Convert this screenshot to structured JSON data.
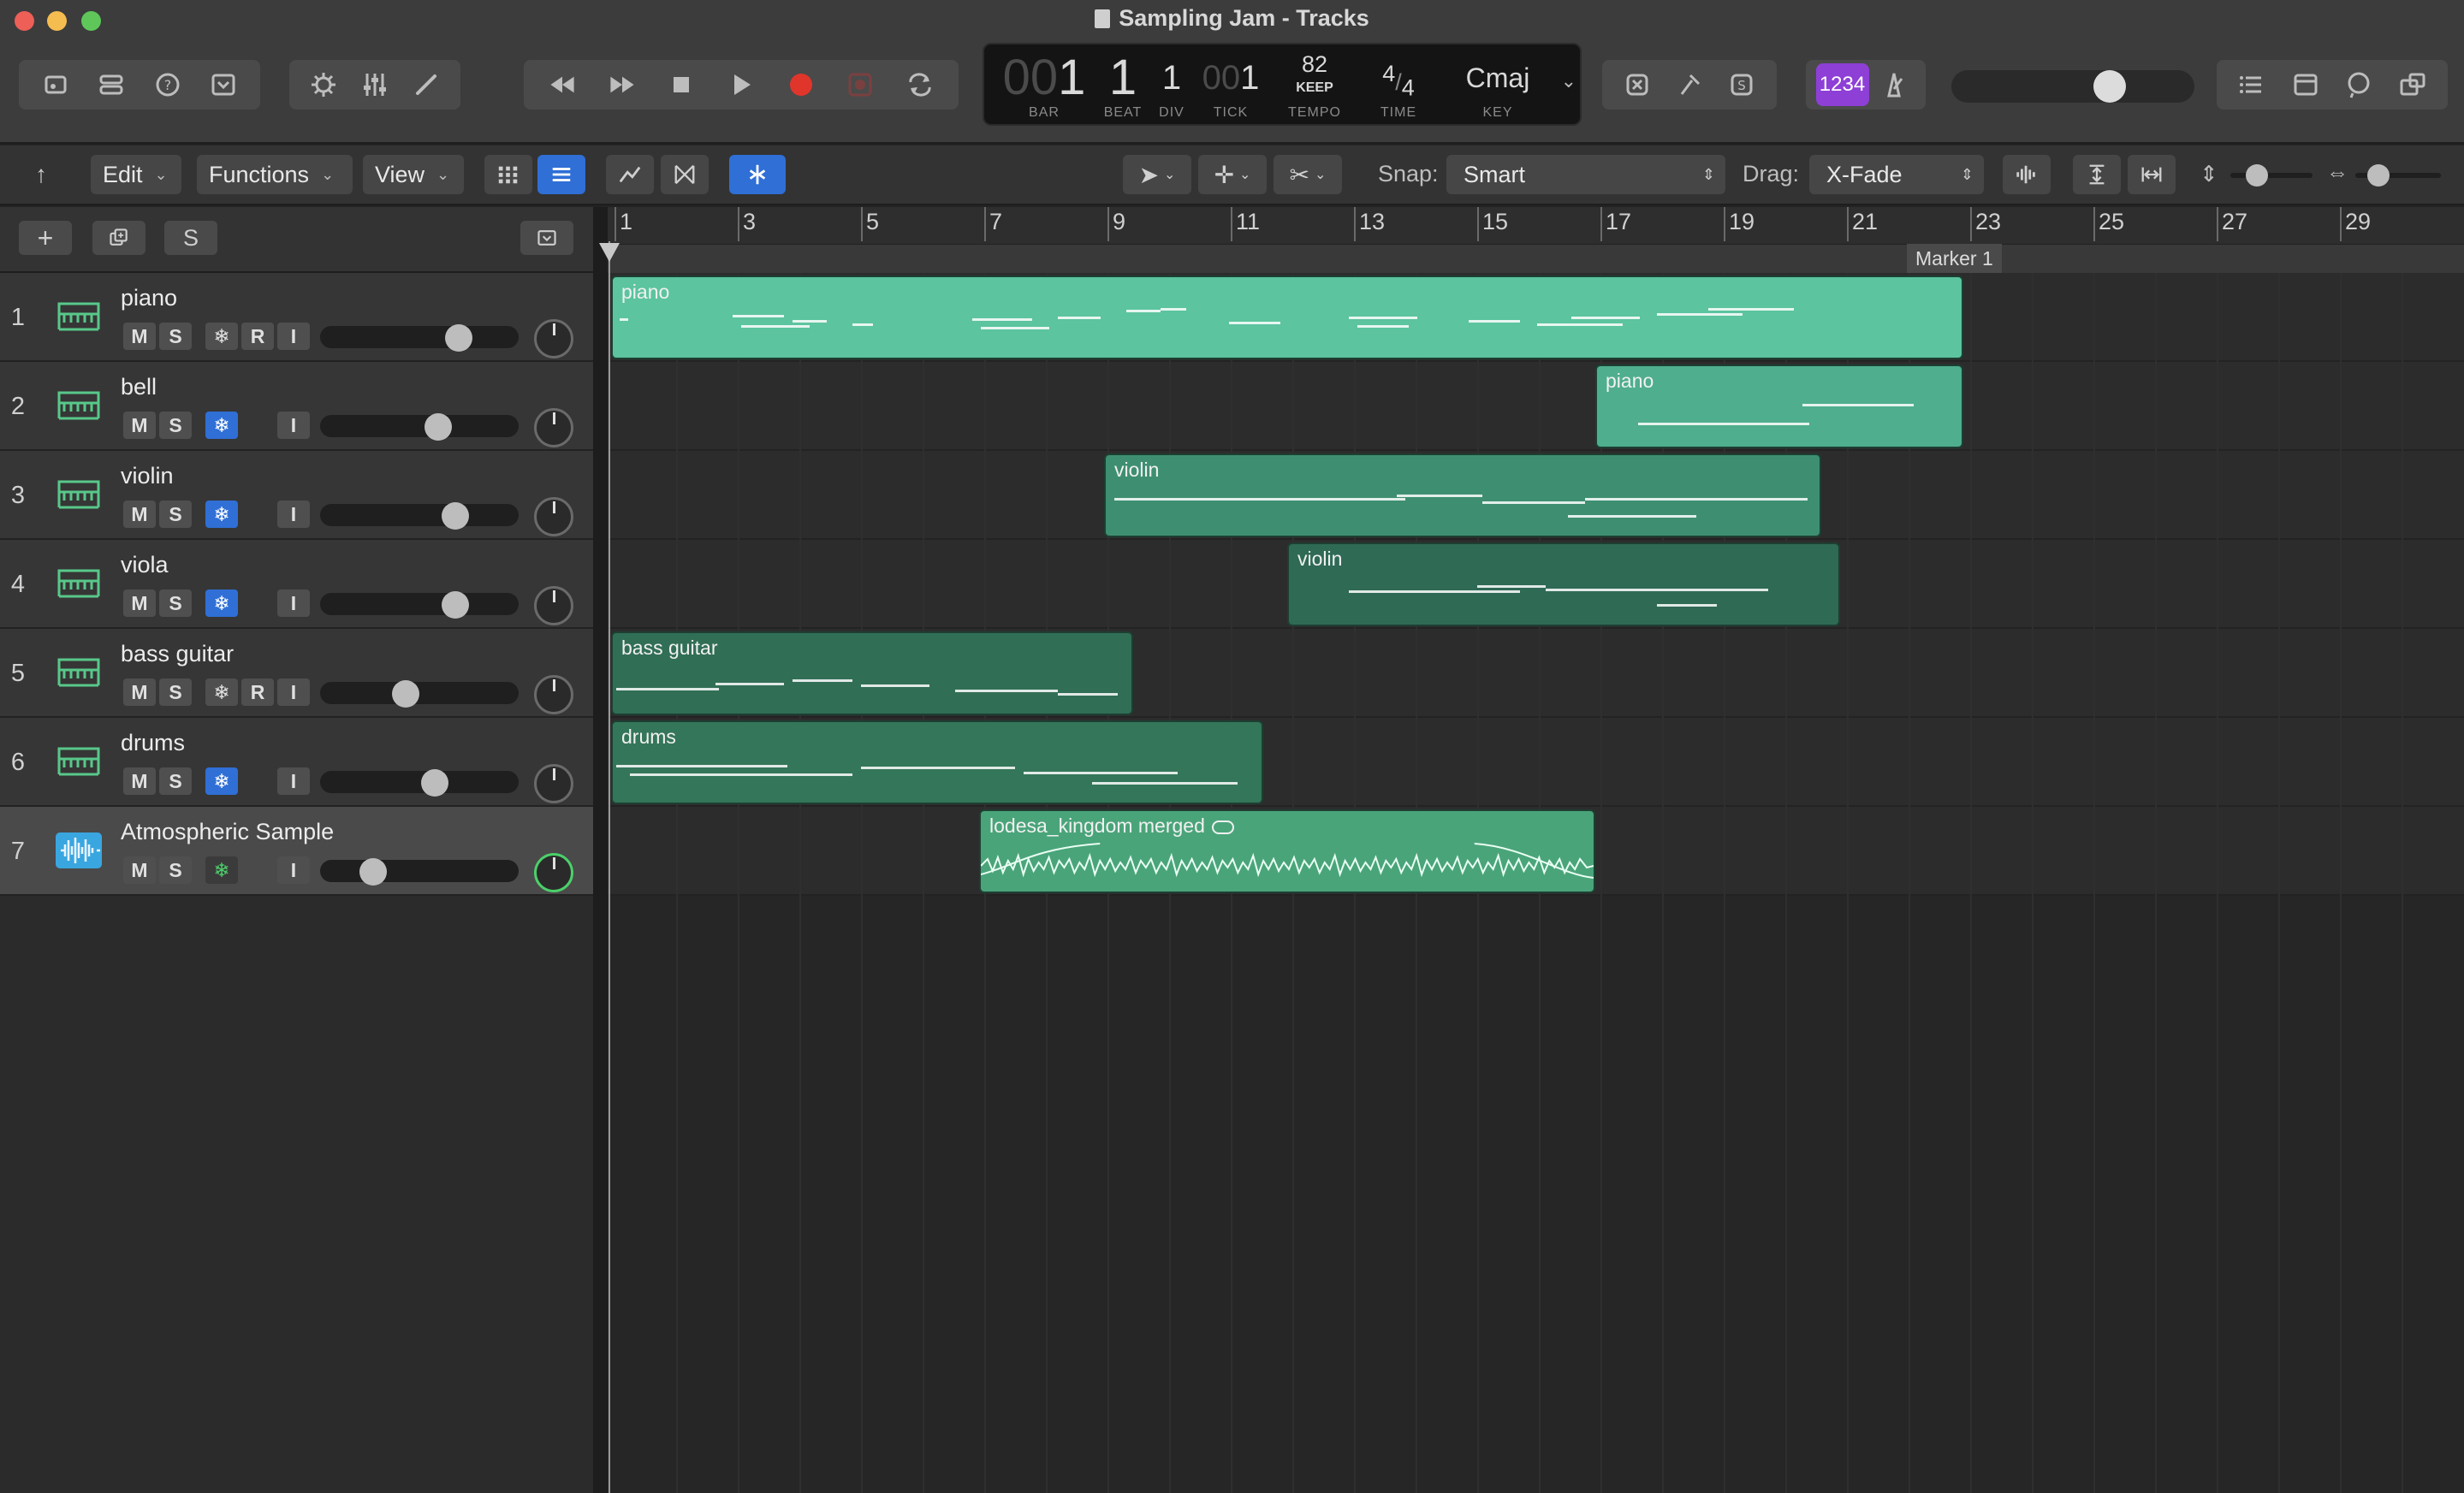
{
  "window": {
    "title": "Sampling Jam - Tracks"
  },
  "lcd": {
    "bar_dim": "00",
    "bar": "1",
    "beat": "1",
    "div": "1",
    "tick_dim": "00",
    "tick": "1",
    "tempo": "82",
    "tempo_mode": "KEEP",
    "time_num": "4",
    "time_den": "4",
    "key": "Cmaj",
    "labels": {
      "bar": "BAR",
      "beat": "BEAT",
      "div": "DIV",
      "tick": "TICK",
      "tempo": "TEMPO",
      "time": "TIME",
      "key": "KEY"
    }
  },
  "count_in": "1234",
  "toolbar2": {
    "edit": "Edit",
    "functions": "Functions",
    "view": "View",
    "snap_label": "Snap:",
    "snap_value": "Smart",
    "drag_label": "Drag:",
    "drag_value": "X-Fade"
  },
  "track_header": {
    "s_label": "S"
  },
  "tracks": [
    {
      "num": "1",
      "name": "piano",
      "m": "M",
      "s": "S",
      "r": "R",
      "i": "I"
    },
    {
      "num": "2",
      "name": "bell",
      "m": "M",
      "s": "S",
      "i": "I"
    },
    {
      "num": "3",
      "name": "violin",
      "m": "M",
      "s": "S",
      "i": "I"
    },
    {
      "num": "4",
      "name": "viola",
      "m": "M",
      "s": "S",
      "i": "I"
    },
    {
      "num": "5",
      "name": "bass guitar",
      "m": "M",
      "s": "S",
      "r": "R",
      "i": "I"
    },
    {
      "num": "6",
      "name": "drums",
      "m": "M",
      "s": "S",
      "i": "I"
    },
    {
      "num": "7",
      "name": "Atmospheric Sample",
      "m": "M",
      "s": "S",
      "i": "I"
    }
  ],
  "ruler": {
    "bars": [
      "1",
      "3",
      "5",
      "7",
      "9",
      "11",
      "13",
      "15",
      "17",
      "19",
      "21",
      "23",
      "25",
      "27",
      "29"
    ],
    "marker": "Marker 1"
  },
  "regions": [
    {
      "name": "piano",
      "track": 1,
      "color": "#5cc49f"
    },
    {
      "name": "piano",
      "track": 2,
      "color": "#4fae8d"
    },
    {
      "name": "violin",
      "track": 3,
      "color": "#3e8f72"
    },
    {
      "name": "violin",
      "track": 4,
      "color": "#2f6a55"
    },
    {
      "name": "bass guitar",
      "track": 5,
      "color": "#316e56"
    },
    {
      "name": "drums",
      "track": 6,
      "color": "#347659"
    },
    {
      "name": "lodesa_kingdom merged",
      "track": 7,
      "color": "#4aa47a"
    }
  ],
  "colors": {
    "accent": "#2f6fd6",
    "record": "#e0352b",
    "count_in": "#8e3fd6",
    "instrument": "#58c88a",
    "audio": "#3aa6e0"
  }
}
